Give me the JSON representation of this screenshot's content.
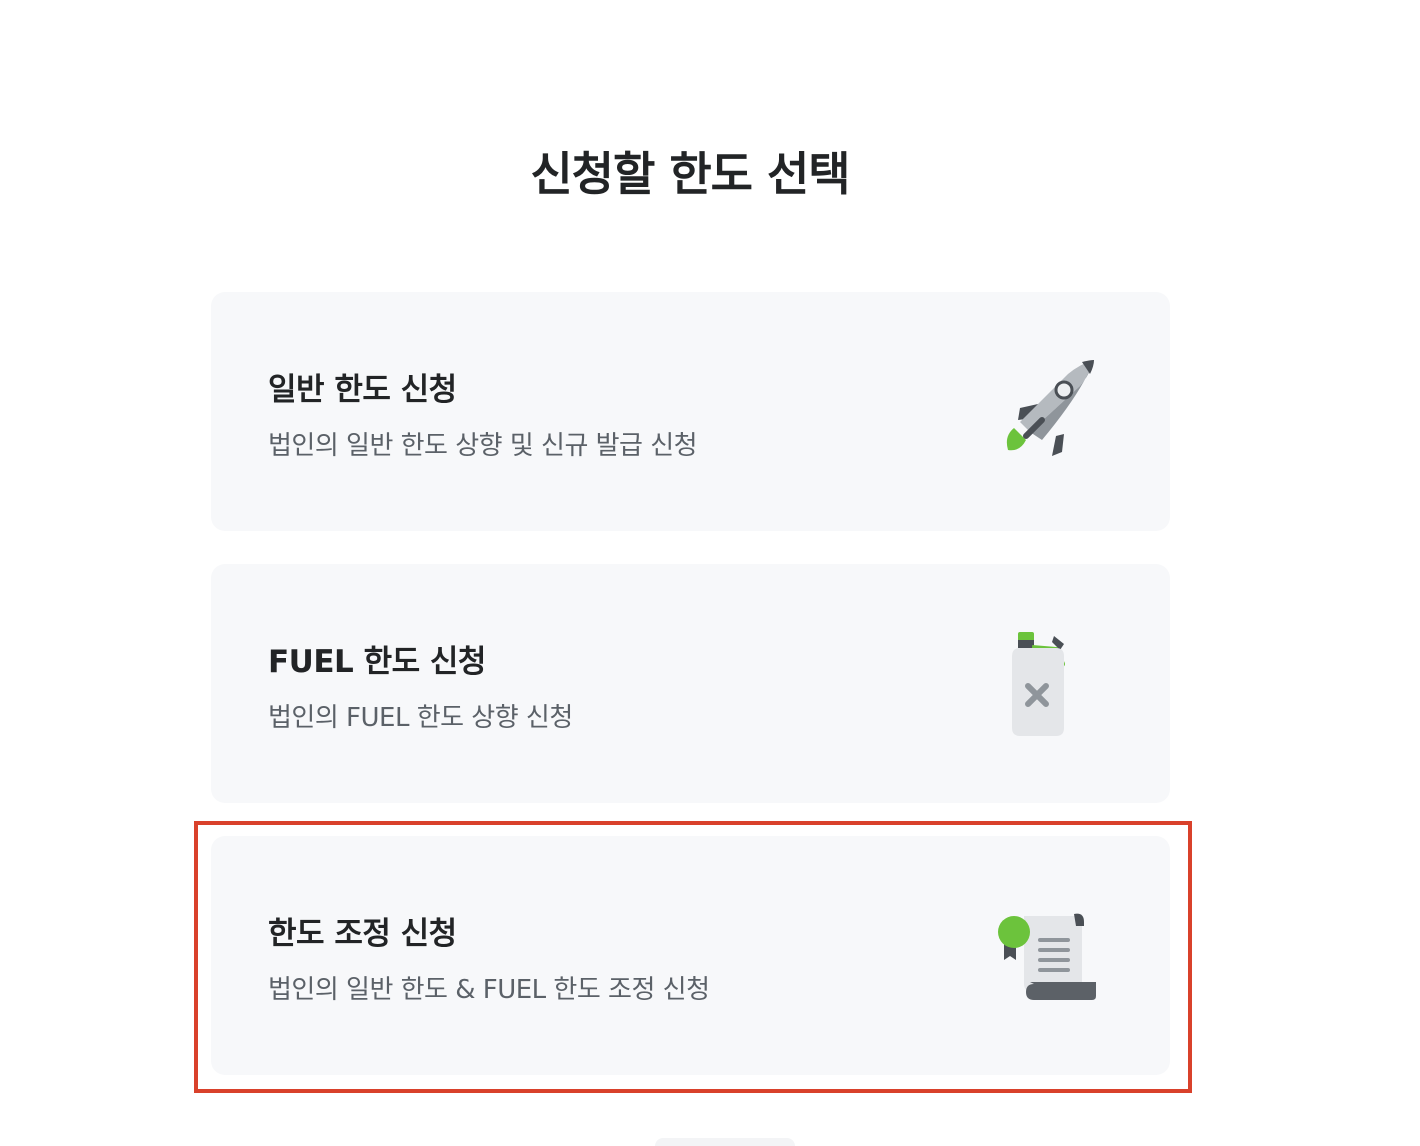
{
  "page": {
    "title": "신청할 한도 선택"
  },
  "options": [
    {
      "title": "일반 한도 신청",
      "description": "법인의 일반 한도 상향 및 신규 발급 신청",
      "icon": "rocket-icon"
    },
    {
      "title": "FUEL 한도 신청",
      "description": "법인의 FUEL 한도 상향 신청",
      "icon": "fuel-can-icon"
    },
    {
      "title": "한도 조정 신청",
      "description": "법인의 일반 한도 & FUEL 한도 조정 신청",
      "icon": "certificate-scroll-icon"
    }
  ],
  "colors": {
    "accent_green": "#6cc33c",
    "card_background": "#f7f8fa",
    "highlight_border": "#d9412b",
    "title_text": "#222426",
    "description_text": "#5b6168"
  }
}
